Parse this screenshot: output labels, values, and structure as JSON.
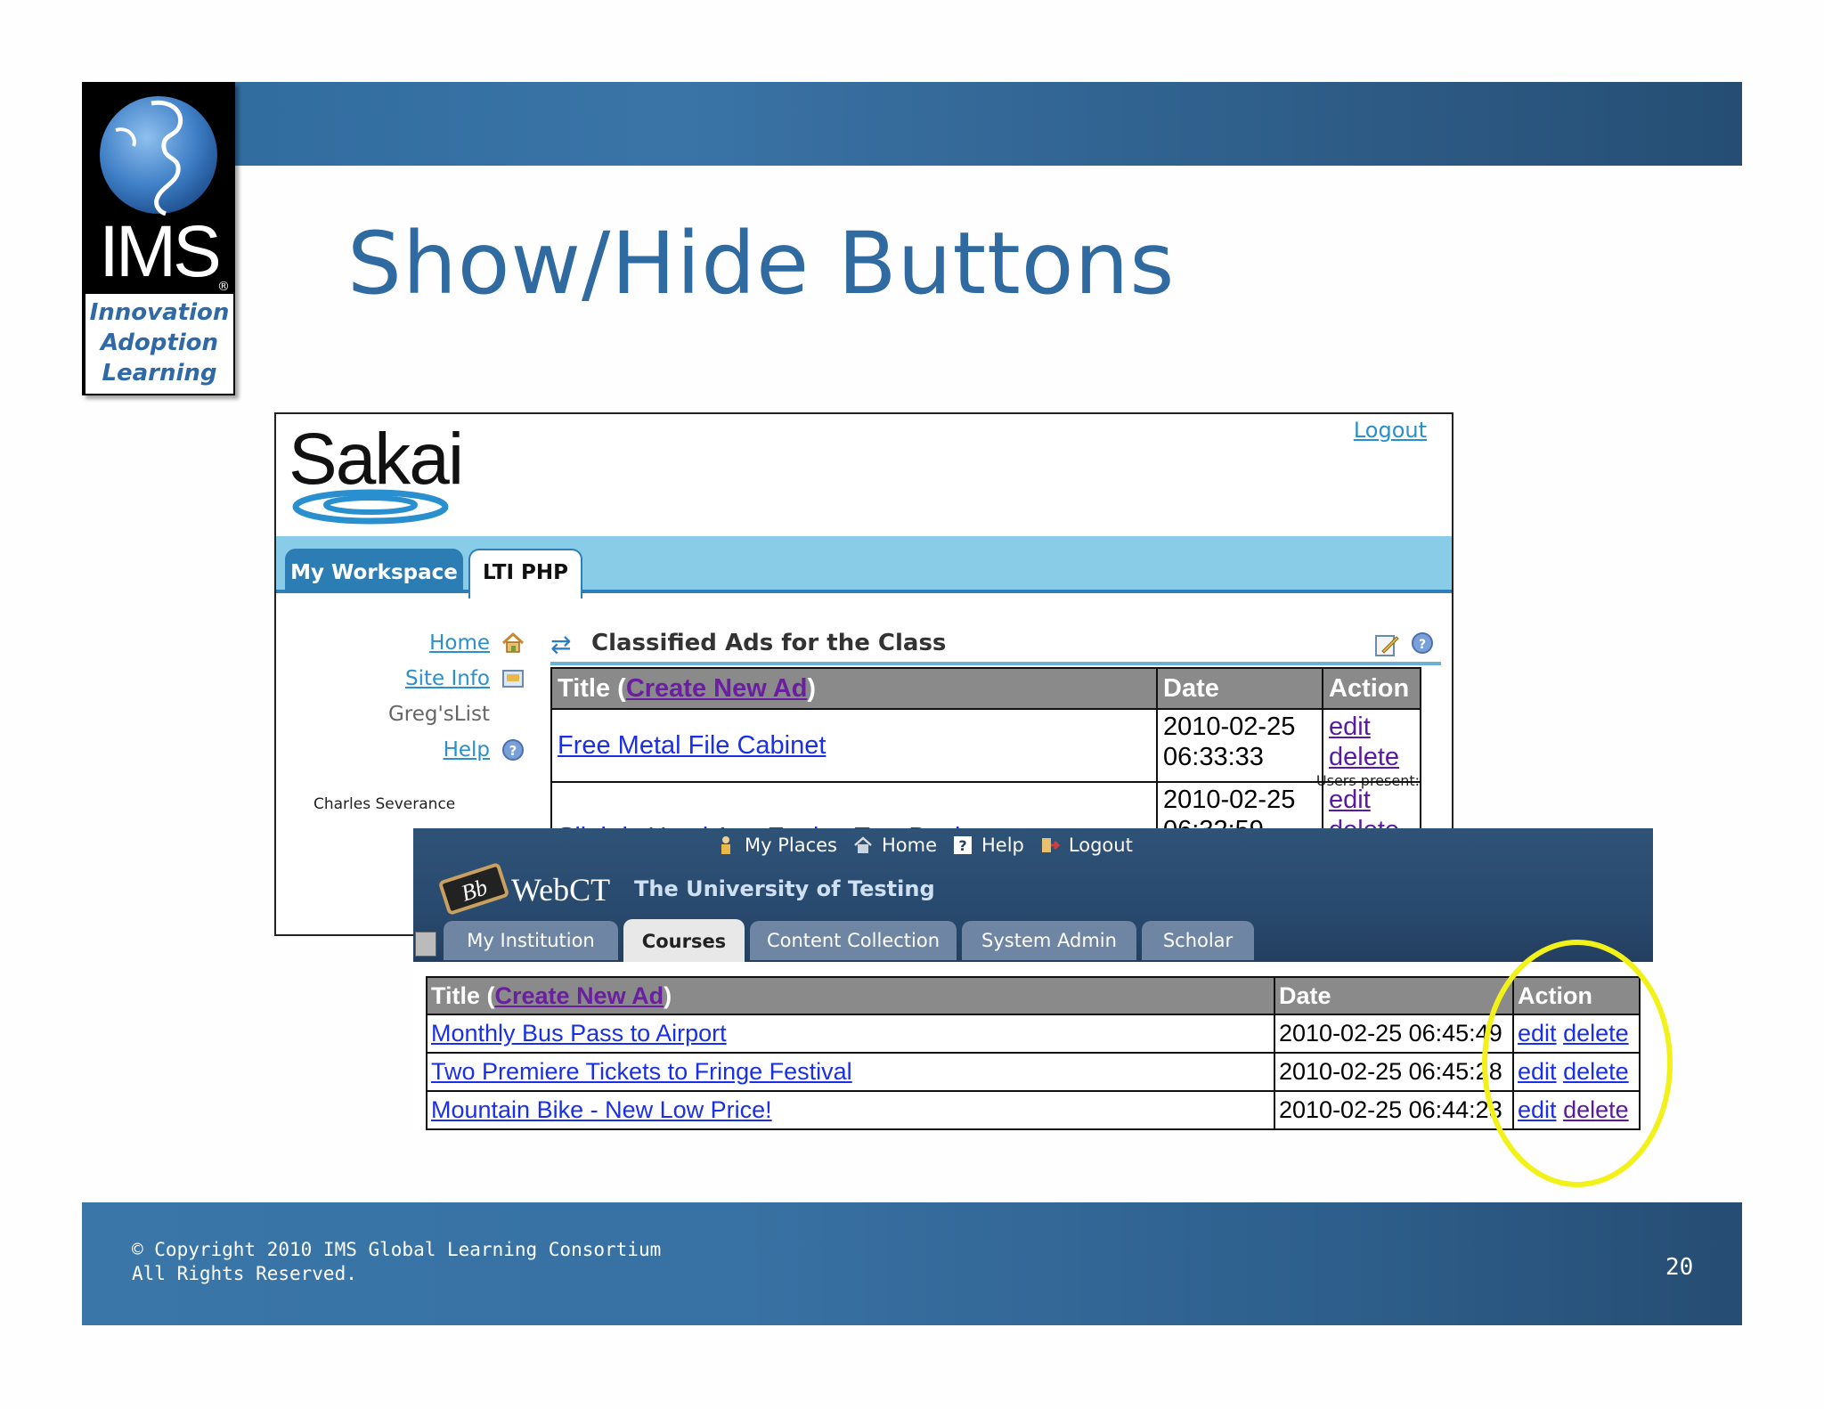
{
  "slide": {
    "logo": {
      "brand": "IMS",
      "tagline": [
        "Innovation",
        "Adoption",
        "Learning"
      ],
      "registered": "®"
    },
    "title": "Show/Hide Buttons",
    "footer": {
      "copyright_line1": "© Copyright 2010 IMS Global Learning Consortium",
      "copyright_line2": "All Rights Reserved.",
      "page_number": "20"
    },
    "colors": {
      "band": "#2f6a9d",
      "title": "#2f6aa0",
      "highlight": "#f2f21a"
    }
  },
  "sakai": {
    "logo_text": "Sakai",
    "logout": "Logout",
    "tabs": [
      {
        "label": "My Workspace",
        "active": false
      },
      {
        "label": "LTI PHP",
        "active": true
      }
    ],
    "nav": [
      {
        "label": "Home",
        "link": true,
        "icon": "home-icon"
      },
      {
        "label": "Site Info",
        "link": true,
        "icon": "site-info-icon"
      },
      {
        "label": "Greg'sList",
        "link": false,
        "icon": ""
      },
      {
        "label": "Help",
        "link": true,
        "icon": "help-icon"
      }
    ],
    "users_present_label": "Users present:",
    "users_present_name": "Charles Severance",
    "tool_title": "Classified Ads for the Class",
    "table": {
      "headers": {
        "title_prefix": "Title (",
        "create_link": "Create New Ad",
        "title_suffix": ")",
        "date": "Date",
        "action": "Action"
      },
      "rows": [
        {
          "title": "Free Metal File Cabinet",
          "date_line1": "2010-02-25",
          "date_line2": "06:33:33",
          "edit": "edit",
          "delete": "delete"
        },
        {
          "title": "Slightly Used App Engine Text Book",
          "date_line1": "2010-02-25",
          "date_line2": "06:32:59",
          "edit": "edit",
          "delete": "delete"
        }
      ]
    }
  },
  "webct": {
    "top_links": [
      {
        "label": "My Places",
        "icon": "person-icon"
      },
      {
        "label": "Home",
        "icon": "home-icon"
      },
      {
        "label": "Help",
        "icon": "help-icon"
      },
      {
        "label": "Logout",
        "icon": "logout-icon"
      }
    ],
    "logo_badge": "Bb",
    "brand": "WebCT",
    "institution": "The University of Testing",
    "tabs": [
      {
        "label": "My Institution",
        "active": false
      },
      {
        "label": "Courses",
        "active": true
      },
      {
        "label": "Content Collection",
        "active": false
      },
      {
        "label": "System Admin",
        "active": false
      },
      {
        "label": "Scholar",
        "active": false
      }
    ],
    "table": {
      "headers": {
        "title_prefix": "Title (",
        "create_link": "Create New Ad",
        "title_suffix": ")",
        "date": "Date",
        "action": "Action"
      },
      "rows": [
        {
          "title": "Monthly Bus Pass to Airport",
          "date": "2010-02-25 06:45:49",
          "edit": "edit",
          "delete": "delete"
        },
        {
          "title": "Two Premiere Tickets to Fringe Festival",
          "date": "2010-02-25 06:45:28",
          "edit": "edit",
          "delete": "delete"
        },
        {
          "title": "Mountain Bike - New Low Price!",
          "date": "2010-02-25 06:44:23",
          "edit": "edit",
          "delete": "delete"
        }
      ]
    }
  }
}
